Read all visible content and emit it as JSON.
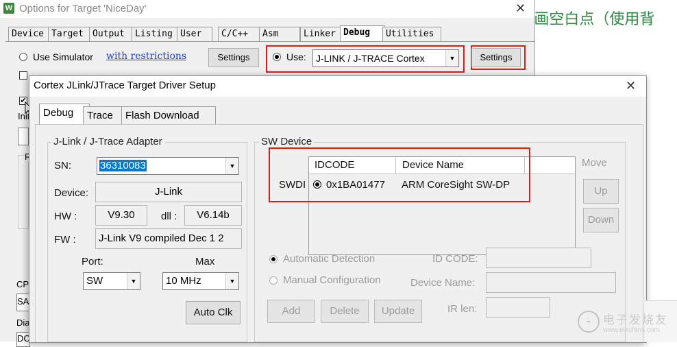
{
  "background_text": {
    "chinese_fragment": "/画空白点（使用背"
  },
  "options_window": {
    "title": "Options for Target 'NiceDay'",
    "icon_letter": "W",
    "tabs": [
      "Device",
      "Target",
      "Output",
      "Listing",
      "User",
      "C/C++",
      "Asm",
      "Linker",
      "Debug",
      "Utilities"
    ],
    "active_tab": "Debug",
    "use_simulator_label": "Use Simulator",
    "with_restrictions_link": "with restrictions",
    "settings_left_label": "Settings",
    "use_label": "Use:",
    "debugger_select_value": "J-LINK / J-TRACE Cortex",
    "settings_right_label": "Settings",
    "partial_labels": {
      "ini": "Init",
      "cp": "CP",
      "sa": "SA",
      "dia": "Dia",
      "dc": "DC",
      "r": "R"
    }
  },
  "dialog": {
    "title": "Cortex JLink/JTrace Target Driver Setup",
    "tabs": [
      "Debug",
      "Trace",
      "Flash Download"
    ],
    "active_tab": "Debug",
    "adapter_group": {
      "label": "J-Link / J-Trace Adapter",
      "sn_label": "SN:",
      "sn_value": "36310083",
      "device_label": "Device:",
      "device_value": "J-Link",
      "hw_label": "HW :",
      "hw_value": "V9.30",
      "dll_label": "dll :",
      "dll_value": "V6.14b",
      "fw_label": "FW :",
      "fw_value": "J-Link V9 compiled Dec  1 2",
      "port_label": "Port:",
      "port_value": "SW",
      "max_label": "Max",
      "max_value": "10 MHz",
      "auto_clk_label": "Auto Clk"
    },
    "sw_device_group": {
      "label": "SW Device",
      "columns": [
        "IDCODE",
        "Device Name"
      ],
      "row_prefix": "SWDI",
      "rows": [
        {
          "idcode": "0x1BA01477",
          "device_name": "ARM CoreSight SW-DP"
        }
      ],
      "move_label": "Move",
      "up_label": "Up",
      "down_label": "Down",
      "automatic_detection_label": "Automatic Detection",
      "manual_configuration_label": "Manual Configuration",
      "id_code_label": "ID CODE:",
      "device_name_label": "Device Name:",
      "ir_len_label": "IR len:",
      "add_label": "Add",
      "delete_label": "Delete",
      "update_label": "Update"
    }
  },
  "watermark": {
    "text": "电子发烧友",
    "url": "www.elecfans.com"
  },
  "colors": {
    "highlight": "#e11919",
    "selection": "#0078d7",
    "chinese_text": "#2c8a3c"
  }
}
